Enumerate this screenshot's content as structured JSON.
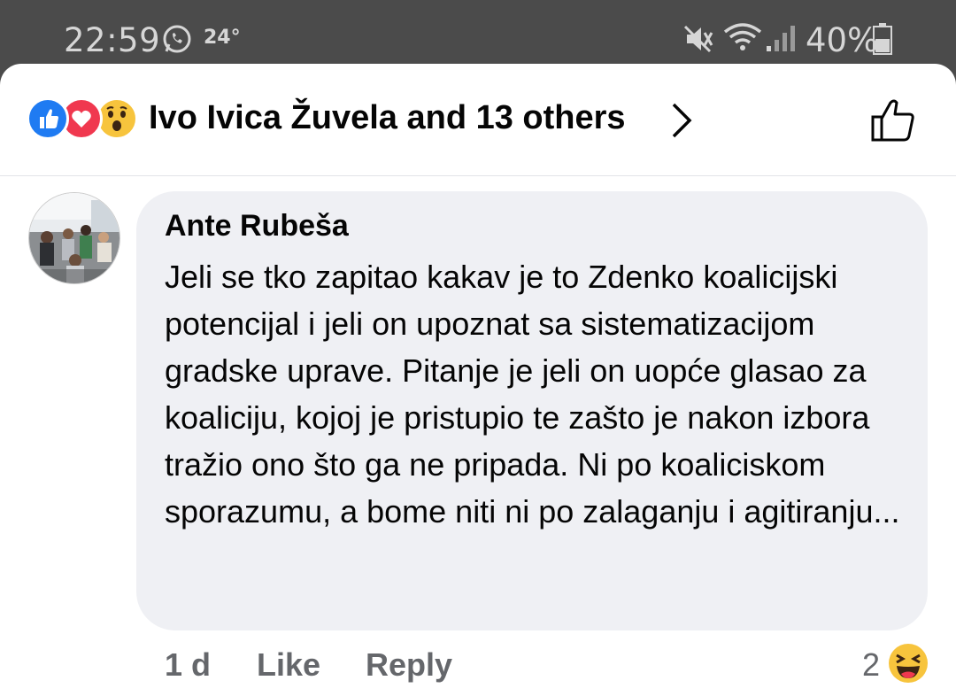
{
  "status_bar": {
    "time": "22:59",
    "temperature": "24°",
    "battery": "40%"
  },
  "reactions_header": {
    "reactions": [
      "like-icon",
      "love-icon",
      "wow-icon"
    ],
    "summary": "Ivo Ivica Žuvela and 13 others"
  },
  "comment": {
    "author": "Ante Rubeša",
    "text": "Jeli se tko zapitao kakav je to Zdenko koalicijski potencijal i jeli on upoznat sa sistematizacijom gradske uprave. Pitanje je jeli on uopće glasao za koaliciju, kojoj je pristupio te zašto je nakon izbora tražio ono što ga ne pripada. Ni po koaliciskom sporazumu, a bome niti ni po zalaganju i agitiranju...",
    "time": "1 d",
    "like_label": "Like",
    "reply_label": "Reply",
    "reaction_count": "2",
    "reaction_icon": "haha-icon"
  },
  "colors": {
    "like": "#1f7bf2",
    "love": "#f0384f",
    "wow": "#f7c43d",
    "bubble": "#eff0f4",
    "secondary_text": "#65676b"
  }
}
